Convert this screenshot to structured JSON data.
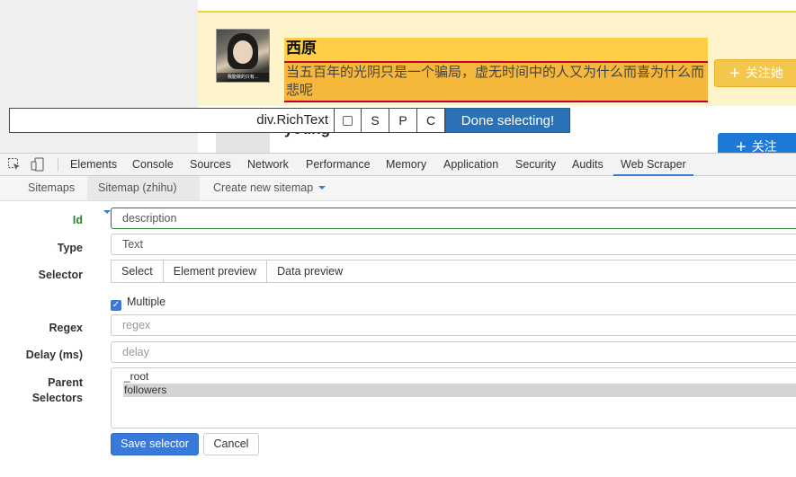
{
  "page": {
    "user1": {
      "name": "西原",
      "bio": "当五百年的光阴只是一个骗局，虚无时间中的人又为什么而喜为什么而悲呢",
      "follow_label": "关注她",
      "avatar_caption": "我能做的只有..."
    },
    "user2": {
      "name": "young",
      "follow_label": "关注"
    }
  },
  "selector_bar": {
    "selector_value": "div.RichText",
    "keys": [
      "S",
      "P",
      "C"
    ],
    "done_label": "Done selecting!"
  },
  "devtools": {
    "tabs": [
      "Elements",
      "Console",
      "Sources",
      "Network",
      "Performance",
      "Memory",
      "Application",
      "Security",
      "Audits",
      "Web Scraper"
    ],
    "active_tab": "Web Scraper",
    "accent": "#3879d9"
  },
  "scraper": {
    "nav": {
      "sitemaps": "Sitemaps",
      "sitemap_zhihu": "Sitemap (zhihu)",
      "create_new": "Create new sitemap"
    },
    "form": {
      "id_label": "Id",
      "id_value": "description",
      "type_label": "Type",
      "type_value": "Text",
      "selector_label": "Selector",
      "select_btn": "Select",
      "element_preview_btn": "Element preview",
      "data_preview_btn": "Data preview",
      "multiple_label": "Multiple",
      "multiple_checked": true,
      "regex_label": "Regex",
      "regex_placeholder": "regex",
      "delay_label": "Delay (ms)",
      "delay_placeholder": "delay",
      "parent_label_line1": "Parent",
      "parent_label_line2": "Selectors",
      "parent_options": [
        "_root",
        "followers"
      ],
      "parent_selected": "followers",
      "save_btn": "Save selector",
      "cancel_btn": "Cancel"
    }
  }
}
